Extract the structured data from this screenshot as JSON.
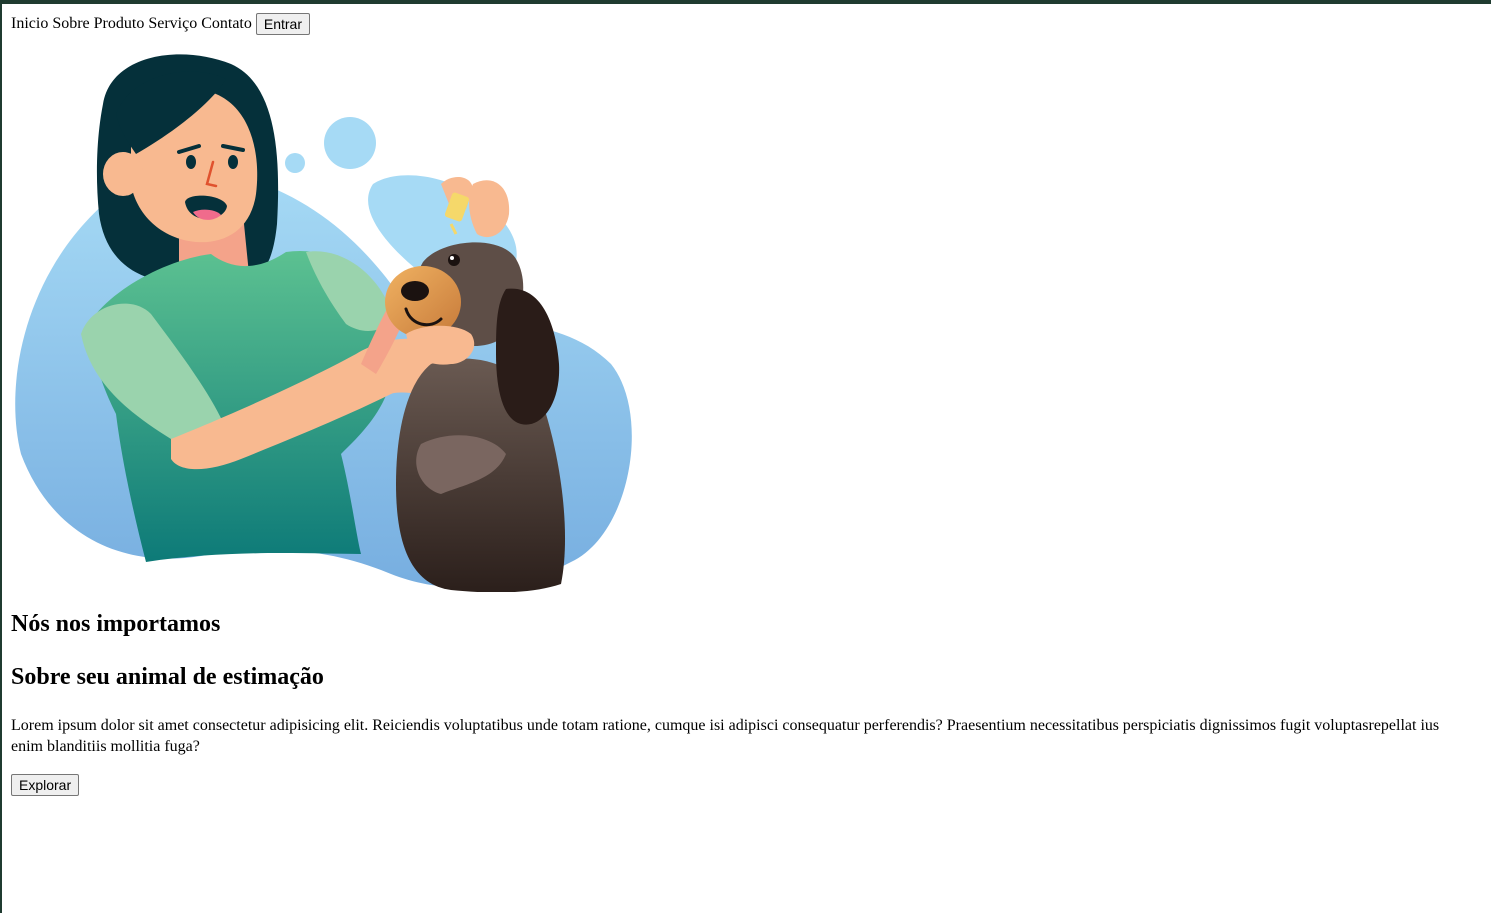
{
  "nav": {
    "links": [
      "Inicio",
      "Sobre",
      "Produto",
      "Serviço",
      "Contato"
    ],
    "login_label": "Entrar"
  },
  "hero": {
    "title": "Nós nos importamos",
    "subtitle": "Sobre seu animal de estimação",
    "body": "Lorem ipsum dolor sit amet consectetur adipisicing elit. Reiciendis voluptatibus unde totam ratione, cumque isi adipisci consequatur perferendis? Praesentium necessitatibus perspiciatis dignissimos fugit voluptasrepellat ius enim blanditiis mollitia fuga?",
    "cta_label": "Explorar"
  },
  "colors": {
    "frame": "#1f3b30",
    "blob": "#8ec7ee",
    "shirt": "#3fae86",
    "hair": "#05303a",
    "skin": "#f8b990",
    "dog": "#4a3a33"
  }
}
